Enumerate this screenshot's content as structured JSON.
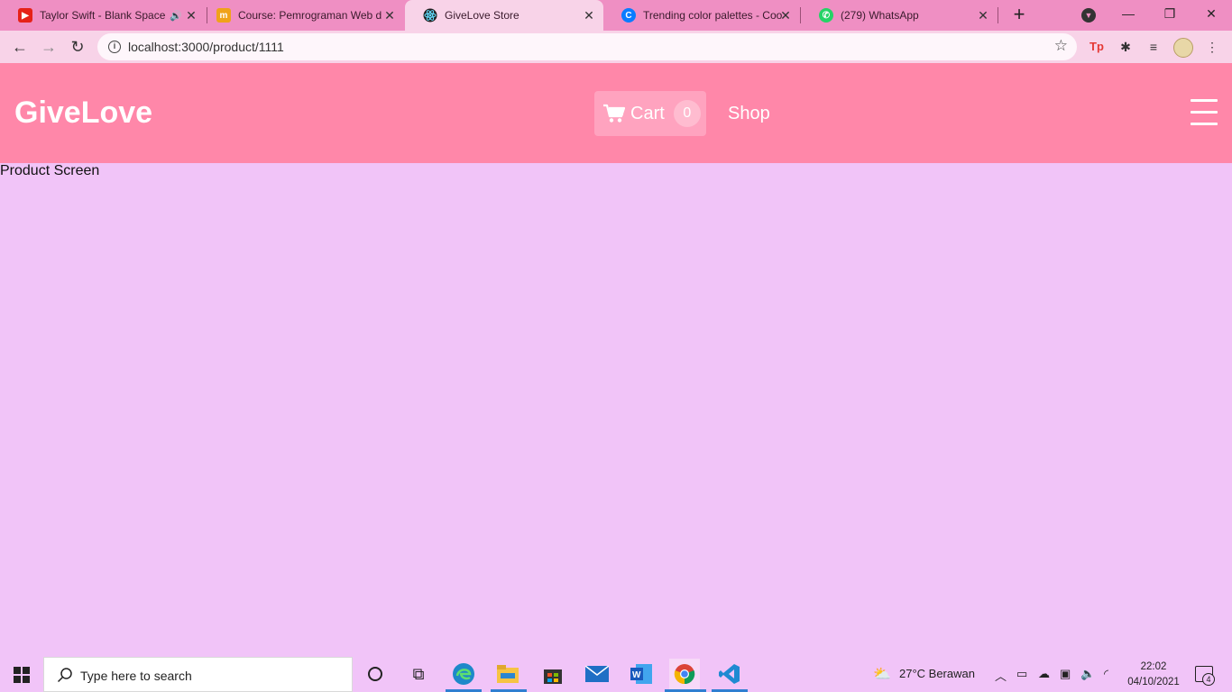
{
  "browser": {
    "tabs": [
      {
        "title": "Taylor Swift - Blank Space",
        "icon": "youtube-icon",
        "audio": true
      },
      {
        "title": "Course: Pemrograman Web d",
        "icon": "moodle-icon"
      },
      {
        "title": "GiveLove Store",
        "icon": "react-icon",
        "active": true
      },
      {
        "title": "Trending color palettes - Coo",
        "icon": "coolors-icon"
      },
      {
        "title": "(279) WhatsApp",
        "icon": "whatsapp-icon"
      }
    ],
    "new_tab": "+",
    "url": "localhost:3000/product/1111"
  },
  "app": {
    "brand": "GiveLove",
    "cart_label": "Cart",
    "cart_count": "0",
    "shop_label": "Shop",
    "colors": {
      "header": "#ff87a9",
      "background": "#f1c4f8",
      "tab_strip": "#ef8fc3"
    }
  },
  "main": {
    "text": "Product Screen"
  },
  "taskbar": {
    "search_placeholder": "Type here to search",
    "weather": "27°C  Berawan",
    "time": "22:02",
    "date": "04/10/2021",
    "notification_count": "4"
  }
}
